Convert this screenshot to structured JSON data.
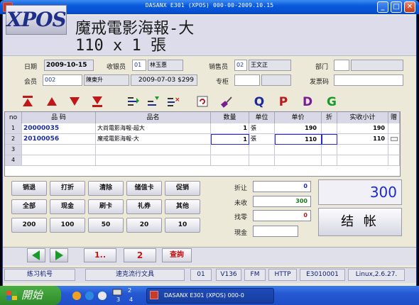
{
  "window": {
    "title": "DASANX E301 (XPOS) 000-00-2009.10.15"
  },
  "header": {
    "logo_text": "XPOS",
    "product_name": "魔戒電影海報-大",
    "qty_line": "110 x 1 張"
  },
  "info": {
    "date_label": "日期",
    "date_value": "2009-10-15",
    "cashier_label": "收银员",
    "cashier_code": "01",
    "cashier_name": "林玉惠",
    "sales_label": "销售员",
    "sales_code": "02",
    "sales_name": "王文正",
    "dept_label": "部门",
    "dept_value": "",
    "member_label": "会员",
    "member_code": "002",
    "member_name": "陳東升",
    "member_info": "2009-07-03 $299",
    "counter_label": "专柜",
    "counter_value": "",
    "invoice_label": "发票码",
    "invoice_value": ""
  },
  "toolbar": {
    "icons": [
      "move-first-icon",
      "move-up-icon",
      "move-down-icon",
      "move-last-icon",
      "insert-row-icon",
      "edit-row-icon",
      "delete-row-icon",
      "refresh-icon",
      "clean-icon",
      "Q",
      "P",
      "D",
      "G"
    ],
    "colors": {
      "red": "#c01818",
      "navy": "#1a2a9a",
      "green": "#1a9a2a",
      "purple": "#7a1a9a"
    }
  },
  "grid": {
    "headers": [
      "no",
      "品 码",
      "品名",
      "数量",
      "单位",
      "单价",
      "折",
      "实收小计",
      "赠"
    ],
    "rows": [
      {
        "no": "1",
        "code": "20000035",
        "name": "大尚電影海報-超大",
        "qty": "1",
        "unit": "張",
        "price": "190",
        "disc": "",
        "subtotal": "190",
        "gift": ""
      },
      {
        "no": "2",
        "code": "20100056",
        "name": "魔戒電影海報-大",
        "qty": "1",
        "unit": "張",
        "price": "110",
        "disc": "",
        "subtotal": "110",
        "gift": ""
      },
      {
        "no": "3",
        "code": "",
        "name": "",
        "qty": "",
        "unit": "",
        "price": "",
        "disc": "",
        "subtotal": "",
        "gift": ""
      },
      {
        "no": "4",
        "code": "",
        "name": "",
        "qty": "",
        "unit": "",
        "price": "",
        "disc": "",
        "subtotal": "",
        "gift": ""
      }
    ]
  },
  "keypad": [
    [
      "销退",
      "打折",
      "清除",
      "储值卡",
      "促销"
    ],
    [
      "全部",
      "现金",
      "刷卡",
      "礼券",
      "其他"
    ],
    [
      "200",
      "100",
      "50",
      "20",
      "10"
    ]
  ],
  "summary": {
    "discount_label": "折让",
    "discount_value": "0",
    "received_label": "未收",
    "received_value": "300",
    "change_label": "找零",
    "change_value": "0",
    "cash_label": "現金",
    "cash_value": "",
    "total": "300",
    "checkout_label": "结 帐"
  },
  "nav": {
    "page1": "1..",
    "page2": "2",
    "query": "查詢"
  },
  "status": [
    "练习机号",
    "速克流行文具",
    "01",
    "V136",
    "FM",
    "HTTP",
    "E3010001",
    "Linux,2.6.27."
  ],
  "taskbar": {
    "start_label": "開始",
    "task_label": "DASANX E301 (XPOS) 000-0",
    "tray_a": "2",
    "tray_b": "3",
    "tray_c": "4"
  }
}
